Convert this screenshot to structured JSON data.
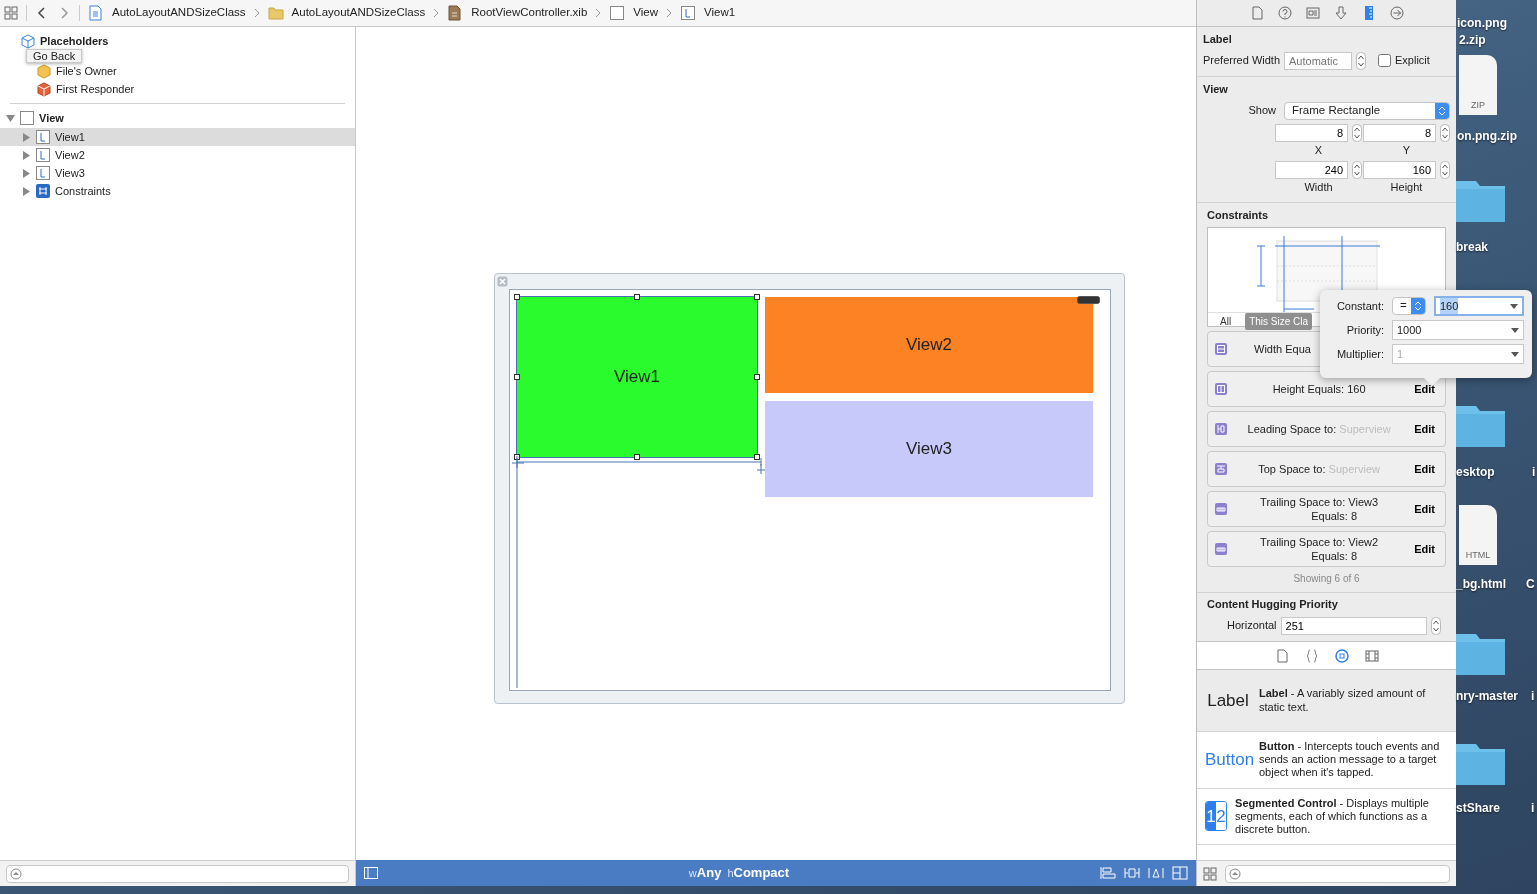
{
  "jump_bar": {
    "crumbs": [
      {
        "label": "AutoLayoutANDSizeClass",
        "kind": "project"
      },
      {
        "label": "AutoLayoutANDSizeClass",
        "kind": "folder"
      },
      {
        "label": "RootViewController.xib",
        "kind": "xib"
      },
      {
        "label": "View",
        "kind": "view"
      },
      {
        "label": "View1",
        "kind": "label"
      }
    ]
  },
  "outline": {
    "placeholders": {
      "label": "Placeholders",
      "items": [
        {
          "label": "File's Owner",
          "kind": "owner"
        },
        {
          "label": "First Responder",
          "kind": "responder"
        }
      ]
    },
    "tree": [
      {
        "label": "View",
        "kind": "view",
        "expanded": true,
        "children": [
          {
            "label": "View1",
            "kind": "label",
            "selected": true,
            "expanded": false
          },
          {
            "label": "View2",
            "kind": "label",
            "selected": false,
            "expanded": false
          },
          {
            "label": "View3",
            "kind": "label",
            "selected": false,
            "expanded": false
          },
          {
            "label": "Constraints",
            "kind": "constraints",
            "selected": false,
            "expanded": false
          }
        ]
      }
    ],
    "tooltip": "Go Back"
  },
  "canvas": {
    "views": [
      {
        "label": "View1",
        "color": "#29fb2c",
        "selected": true
      },
      {
        "label": "View2",
        "color": "#fd8224",
        "selected": false
      },
      {
        "label": "View3",
        "color": "#c6c9fa",
        "selected": false
      }
    ],
    "size_class": {
      "width_prefix": "w",
      "width": "Any",
      "height_prefix": "h",
      "height": "Compact"
    }
  },
  "inspector": {
    "tabs": [
      {
        "kind": "file",
        "selected": false
      },
      {
        "kind": "help",
        "selected": false
      },
      {
        "kind": "identity",
        "selected": false
      },
      {
        "kind": "attributes",
        "selected": false
      },
      {
        "kind": "size",
        "selected": true
      },
      {
        "kind": "connections",
        "selected": false
      }
    ],
    "label_section": {
      "title": "Label",
      "preferred_width_label": "Preferred Width",
      "preferred_width_placeholder": "Automatic",
      "explicit": {
        "label": "Explicit",
        "checked": false
      }
    },
    "view_section": {
      "title": "View",
      "show_label": "Show",
      "show_value": "Frame Rectangle",
      "fields": [
        {
          "label": "X",
          "value": "8"
        },
        {
          "label": "Y",
          "value": "8"
        },
        {
          "label": "Width",
          "value": "240"
        },
        {
          "label": "Height",
          "value": "160"
        }
      ]
    },
    "constraints": {
      "title": "Constraints",
      "filters": [
        {
          "label": "All",
          "selected": false
        },
        {
          "label": "This Size Cla",
          "selected": true
        }
      ],
      "items": [
        {
          "kind": "width",
          "text": "Width Equa"
        },
        {
          "kind": "height",
          "text": "Height Equals:",
          "target": "160",
          "dim": false,
          "edit": "Edit"
        },
        {
          "kind": "leading",
          "text": "Leading Space to:",
          "target": "Superview",
          "dim": true,
          "edit": "Edit"
        },
        {
          "kind": "top",
          "text": "Top Space to:",
          "target": "Superview",
          "dim": true,
          "edit": "Edit"
        },
        {
          "kind": "trailing",
          "text": "Trailing Space to:",
          "target": "View3",
          "dim": false,
          "equals_label": "Equals:",
          "equals": "8",
          "edit": "Edit"
        },
        {
          "kind": "trailing",
          "text": "Trailing Space to:",
          "target": "View2",
          "dim": false,
          "equals_label": "Equals:",
          "equals": "8",
          "edit": "Edit"
        }
      ],
      "footer": "Showing 6 of 6"
    },
    "hugging": {
      "title": "Content Hugging Priority",
      "horizontal_label": "Horizontal",
      "horizontal_value": "251"
    },
    "library_tabs": [
      {
        "kind": "file",
        "selected": false
      },
      {
        "kind": "code",
        "selected": false
      },
      {
        "kind": "object",
        "selected": true
      },
      {
        "kind": "media",
        "selected": false
      }
    ],
    "library": [
      {
        "kind": "label",
        "preview": "Label",
        "description": "**Label** - A variably sized amount of static text.",
        "selected": true
      },
      {
        "kind": "button",
        "preview": "Button",
        "description": "**Button** - Intercepts touch events and sends an action message to a target object when it's tapped.",
        "selected": false
      },
      {
        "kind": "segmented",
        "segments": [
          "1",
          "2"
        ],
        "description": "**Segmented Control** - Displays multiple segments, each of which functions as a discrete button.",
        "selected": false
      }
    ]
  },
  "popover": {
    "rows": [
      {
        "label": "Constant:",
        "relation": "=",
        "value": "160",
        "focused": true,
        "dim": false
      },
      {
        "label": "Priority:",
        "value": "1000",
        "focused": false,
        "dim": false
      },
      {
        "label": "Multiplier:",
        "value": "1",
        "focused": false,
        "dim": true
      }
    ]
  },
  "desktop": {
    "items": [
      {
        "kind": "label",
        "text": "icon.png"
      },
      {
        "kind": "label",
        "text": "2.zip"
      },
      {
        "kind": "file",
        "caption": "ZIP"
      },
      {
        "kind": "label",
        "text": "on.png.zip"
      },
      {
        "kind": "folder"
      },
      {
        "kind": "label",
        "text": "break"
      },
      {
        "kind": "folder"
      },
      {
        "kind": "label",
        "text": "esktop"
      },
      {
        "kind": "label",
        "text": "i"
      },
      {
        "kind": "file",
        "caption": "HTML"
      },
      {
        "kind": "label",
        "text": "_bg.html"
      },
      {
        "kind": "label",
        "text": "C"
      },
      {
        "kind": "folder"
      },
      {
        "kind": "label",
        "text": "nry-master"
      },
      {
        "kind": "label",
        "text": "i"
      },
      {
        "kind": "folder"
      },
      {
        "kind": "label",
        "text": "stShare"
      },
      {
        "kind": "label",
        "text": "i"
      }
    ]
  }
}
